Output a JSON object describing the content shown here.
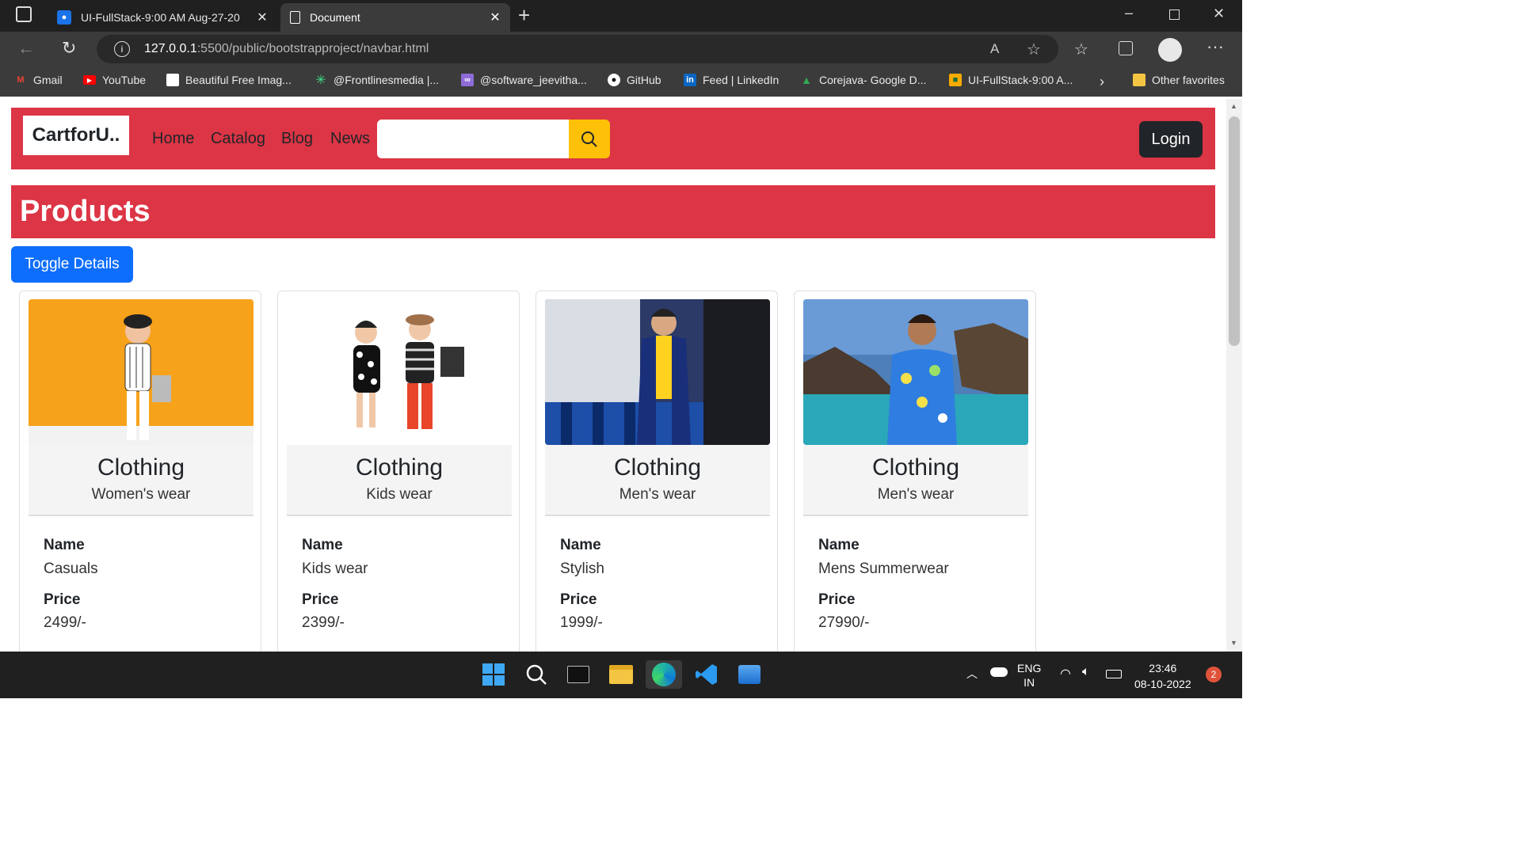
{
  "browser": {
    "tabs": [
      {
        "label": "UI-FullStack-9:00 AM Aug-27-20"
      },
      {
        "label": "Document"
      }
    ],
    "url_host": "127.0.0.1",
    "url_path": ":5500/public/bootstrapproject/navbar.html",
    "bookmarks": [
      {
        "label": "Gmail",
        "icon": "gmail-icon",
        "color": "#ea4335"
      },
      {
        "label": "YouTube",
        "icon": "youtube-icon",
        "color": "#ff0000"
      },
      {
        "label": "Beautiful Free Imag...",
        "icon": "unsplash-icon",
        "color": "#000000"
      },
      {
        "label": "@Frontlinesmedia |...",
        "icon": "frontlines-icon",
        "color": "#3ddc84"
      },
      {
        "label": "@software_jeevitha...",
        "icon": "link-icon",
        "color": "#8e6bd8"
      },
      {
        "label": "GitHub",
        "icon": "github-icon",
        "color": "#ffffff"
      },
      {
        "label": "Feed | LinkedIn",
        "icon": "linkedin-icon",
        "color": "#0a66c2"
      },
      {
        "label": "Corejava- Google D...",
        "icon": "google-drive-icon",
        "color": "#34a853"
      },
      {
        "label": "UI-FullStack-9:00 A...",
        "icon": "classroom-icon",
        "color": "#f9ab00"
      }
    ],
    "other_favorites": "Other favorites"
  },
  "page": {
    "brand": "CartforU..",
    "nav": [
      "Home",
      "Catalog",
      "Blog",
      "News"
    ],
    "search_placeholder": "",
    "login": "Login",
    "heading": "Products",
    "toggle": "Toggle Details",
    "name_label": "Name",
    "price_label": "Price",
    "products": [
      {
        "category": "Clothing",
        "subtitle": "Women's wear",
        "name": "Casuals",
        "price": "2499/-",
        "img_bg": "#f7a21b"
      },
      {
        "category": "Clothing",
        "subtitle": "Kids wear",
        "name": "Kids wear",
        "price": "2399/-",
        "img_bg": "#ffffff"
      },
      {
        "category": "Clothing",
        "subtitle": "Men's wear",
        "name": "Stylish",
        "price": "1999/-",
        "img_bg": "#2b3a66"
      },
      {
        "category": "Clothing",
        "subtitle": "Men's wear",
        "name": "Mens Summerwear",
        "price": "27990/-",
        "img_bg": "#4e7fb8"
      }
    ]
  },
  "taskbar": {
    "lang1": "ENG",
    "lang2": "IN",
    "time": "23:46",
    "date": "08-10-2022",
    "notifications": "2"
  },
  "colors": {
    "primary": "#dc3545",
    "accent": "#ffc107",
    "button": "#0d6efd",
    "dark": "#212529"
  }
}
